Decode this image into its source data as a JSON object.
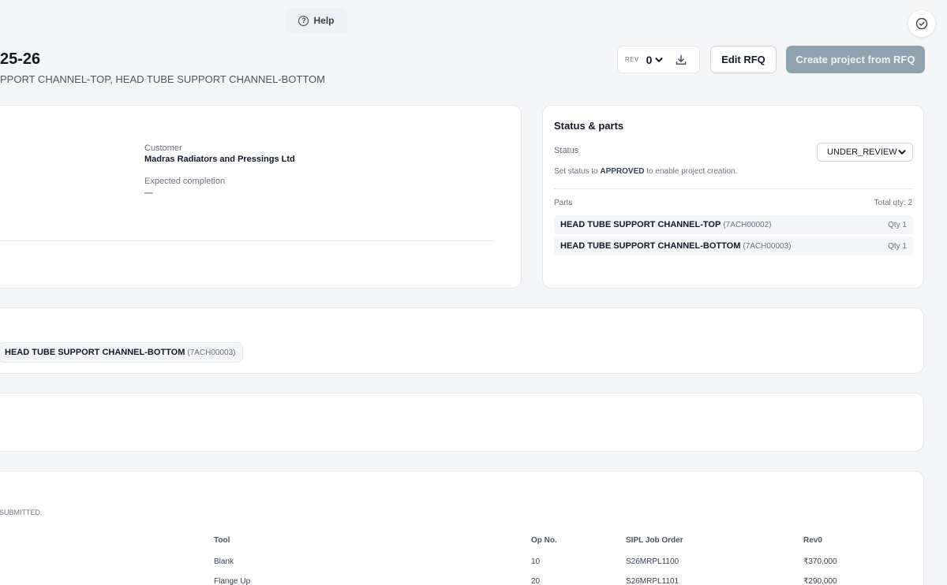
{
  "header": {
    "help_label": "Help",
    "title": "25-26",
    "subtitle": "PPORT CHANNEL-TOP, HEAD TUBE SUPPORT CHANNEL-BOTTOM",
    "rev_label": "REV",
    "rev_value": "0",
    "edit_label": "Edit RFQ",
    "create_label": "Create project from RFQ"
  },
  "details": {
    "customer_label": "Customer",
    "customer_value": "Madras Radiators and Pressings Ltd",
    "completion_label": "Expected completion",
    "completion_value": "—"
  },
  "status_panel": {
    "title": "Status & parts",
    "status_label": "Status",
    "status_value": "UNDER_REVIEW",
    "hint_prefix": "Set status to",
    "hint_status": "APPROVED",
    "hint_suffix": "to enable project creation.",
    "parts_label": "Parts",
    "total_qty": "Total qty: 2",
    "parts": [
      {
        "name": "HEAD TUBE SUPPORT CHANNEL-TOP",
        "code": "(7ACH00002)",
        "qty": "Qty 1"
      },
      {
        "name": "HEAD TUBE SUPPORT CHANNEL-BOTTOM",
        "code": "(7ACH00003)",
        "qty": "Qty 1"
      }
    ]
  },
  "parts_card": {
    "chip_name": "HEAD TUBE SUPPORT CHANNEL-BOTTOM",
    "chip_code": "(7ACH00003)"
  },
  "ops": {
    "note": "SUBMITTED.",
    "headers": [
      "Tool",
      "Op No.",
      "SIPL Job Order",
      "Rev0"
    ],
    "rows": [
      [
        "Blank",
        "10",
        "S26MRPL1100",
        "₹370,000"
      ],
      [
        "Flange Up",
        "20",
        "S26MRPL1101",
        "₹290,000"
      ]
    ]
  }
}
